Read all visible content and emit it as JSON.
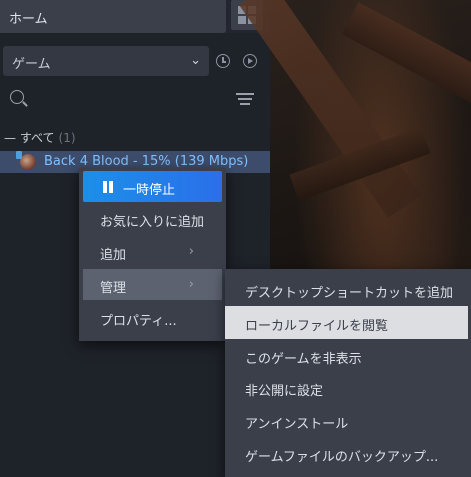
{
  "sidebar": {
    "home_label": "ホーム",
    "filter_select_value": "ゲーム",
    "section_label": "すべて",
    "section_count": "(1)",
    "game_entry": "Back 4 Blood - 15% (139 Mbps)"
  },
  "context_menu": {
    "items": [
      {
        "label": "一時停止"
      },
      {
        "label": "お気に入りに追加"
      },
      {
        "label": "追加",
        "arrow": "›"
      },
      {
        "label": "管理",
        "arrow": "›"
      },
      {
        "label": "プロパティ..."
      }
    ]
  },
  "submenu": {
    "items": [
      {
        "label": "デスクトップショートカットを追加"
      },
      {
        "label": "ローカルファイルを閲覧"
      },
      {
        "label": "このゲームを非表示"
      },
      {
        "label": "非公開に設定"
      },
      {
        "label": "アンインストール"
      },
      {
        "label": "ゲームファイルのバックアップ..."
      }
    ]
  },
  "icons": {
    "grid": "grid-view-icon",
    "clock": "clock-icon",
    "play": "play-icon",
    "search": "search-icon",
    "filter": "filter-icon"
  },
  "colors": {
    "highlight": "#1c8fe8",
    "selected_row": "#3d4c6b",
    "menu_bg": "#3a3f4a"
  }
}
